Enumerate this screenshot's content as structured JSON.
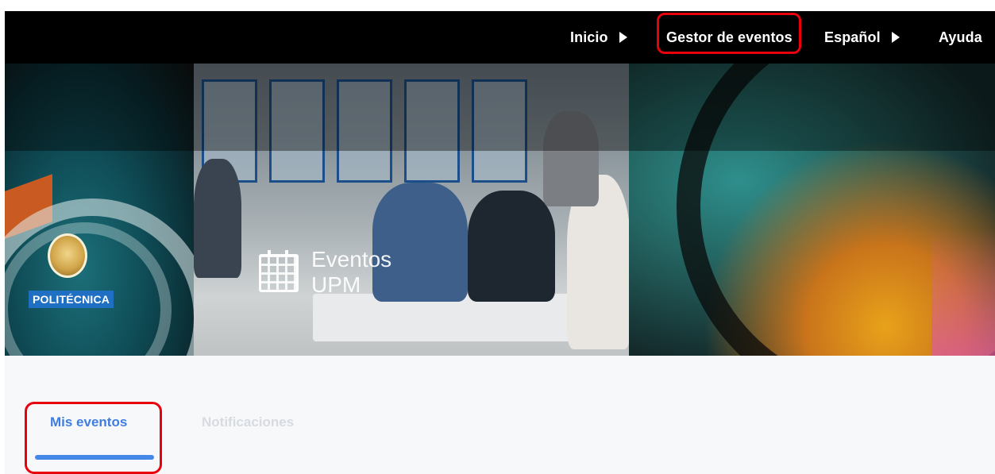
{
  "nav": {
    "items": [
      {
        "label": "Inicio",
        "has_caret": true
      },
      {
        "label": "Gestor de eventos",
        "has_caret": false
      },
      {
        "label": "Español",
        "has_caret": true
      },
      {
        "label": "Ayuda",
        "has_caret": false
      }
    ]
  },
  "banner": {
    "university_label": "POLITÉCNICA",
    "brand_line1": "Eventos",
    "brand_line2": "UPM"
  },
  "tabs": {
    "items": [
      {
        "label": "Mis eventos",
        "active": true
      },
      {
        "label": "Notificaciones",
        "active": false
      }
    ]
  },
  "colors": {
    "nav_background": "#000000",
    "accent": "#3f7de0",
    "highlight": "#e8000d",
    "upm_blue": "#1f6fc3"
  }
}
